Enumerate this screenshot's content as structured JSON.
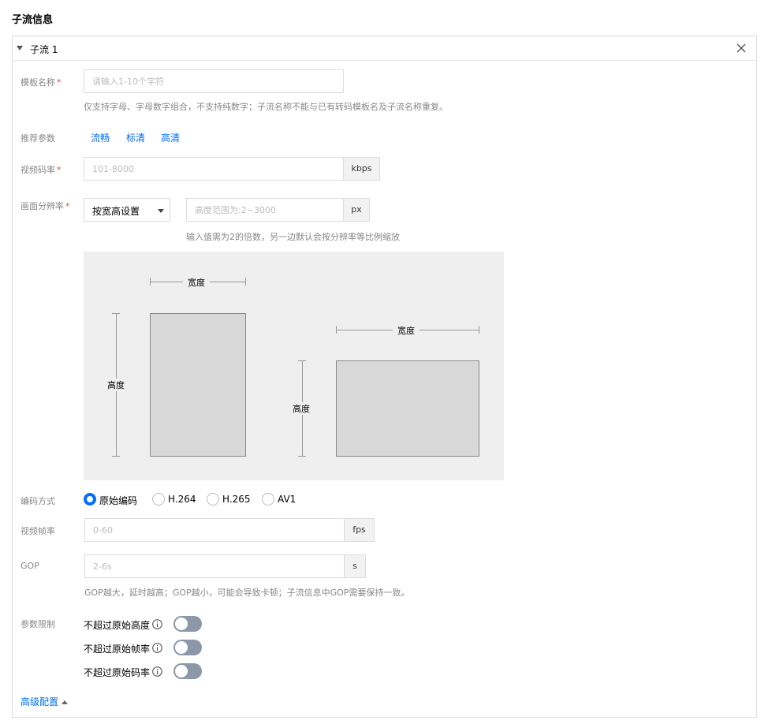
{
  "section_title": "子流信息",
  "panel": {
    "title": "子流 1"
  },
  "template_name": {
    "label": "模板名称",
    "required": "*",
    "placeholder": "请输入1-10个字符",
    "hint": "仅支持字母、字母数字组合，不支持纯数字；子流名称不能与已有转码模板名及子流名称重复。"
  },
  "recommended": {
    "label": "推荐参数",
    "options": [
      "流畅",
      "标清",
      "高清"
    ]
  },
  "bitrate": {
    "label": "视频码率",
    "required": "*",
    "placeholder": "101-8000",
    "unit": "kbps"
  },
  "resolution": {
    "label": "画面分辨率",
    "required": "*",
    "select_value": "按宽高设置",
    "placeholder": "高度范围为:2~3000",
    "unit": "px",
    "hint": "输入值需为2的倍数，另一边默认会按分辨率等比例缩放"
  },
  "diagram": {
    "portrait_width": "宽度",
    "portrait_height": "高度",
    "landscape_width": "宽度",
    "landscape_height": "高度"
  },
  "encoding": {
    "label": "编码方式",
    "options": [
      "原始编码",
      "H.264",
      "H.265",
      "AV1"
    ],
    "selected": "原始编码"
  },
  "framerate": {
    "label": "视频帧率",
    "placeholder": "0-60",
    "unit": "fps"
  },
  "gop": {
    "label": "GOP",
    "placeholder": "2-6s",
    "unit": "s",
    "hint": "GOP越大，延时越高；GOP越小，可能会导致卡顿；子流信息中GOP需要保持一致。"
  },
  "limits": {
    "label": "参数限制",
    "items": [
      {
        "label": "不超过原始高度",
        "on": false
      },
      {
        "label": "不超过原始帧率",
        "on": false
      },
      {
        "label": "不超过原始码率",
        "on": false
      }
    ]
  },
  "advanced_label": "高级配置",
  "colors": {
    "accent": "#006eff",
    "required": "#e54545",
    "toggle_off": "#8c97a8"
  }
}
